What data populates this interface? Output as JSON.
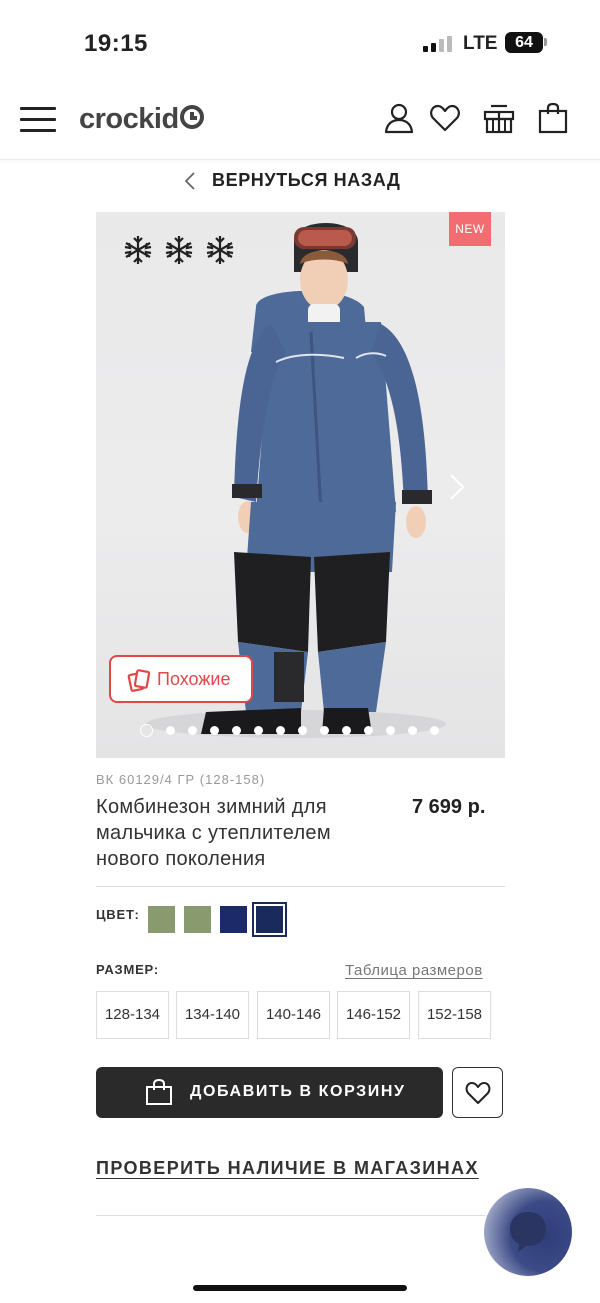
{
  "status_bar": {
    "time": "19:15",
    "network": "LTE",
    "battery": "64"
  },
  "header": {
    "logo": "crockid",
    "icons": [
      "menu-icon",
      "account-icon",
      "heart-icon",
      "gift-icon",
      "cart-icon"
    ]
  },
  "nav": {
    "back_label": "ВЕРНУТЬСЯ НАЗАД"
  },
  "gallery": {
    "badge": "NEW",
    "similar_label": "Похожие",
    "snowflake_count": 3,
    "slides_total": 14,
    "active_slide": 1
  },
  "product": {
    "sku": "ВК 60129/4 ГР (128-158)",
    "title": "Комбинезон зимний для мальчика с утеплителем нового поколения",
    "price": "7 699 р."
  },
  "color": {
    "label": "ЦВЕТ:",
    "swatches": [
      {
        "color": "#8a9a6f",
        "selected": false
      },
      {
        "color": "#8a9a6f",
        "selected": false
      },
      {
        "color": "#1d2a6a",
        "selected": false
      },
      {
        "color": "#1b2a5c",
        "selected": true
      }
    ]
  },
  "size": {
    "label": "РАЗМЕР:",
    "table_link": "Таблица размеров",
    "options": [
      "128-134",
      "134-140",
      "140-146",
      "146-152",
      "152-158"
    ]
  },
  "actions": {
    "add_to_cart": "ДОБАВИТЬ В КОРЗИНУ",
    "check_stores": "ПРОВЕРИТЬ НАЛИЧИЕ В МАГАЗИНАХ"
  },
  "colors": {
    "accent_red": "#e04848",
    "badge_bg": "#f26d72",
    "button_dark": "#2a2a2a"
  }
}
